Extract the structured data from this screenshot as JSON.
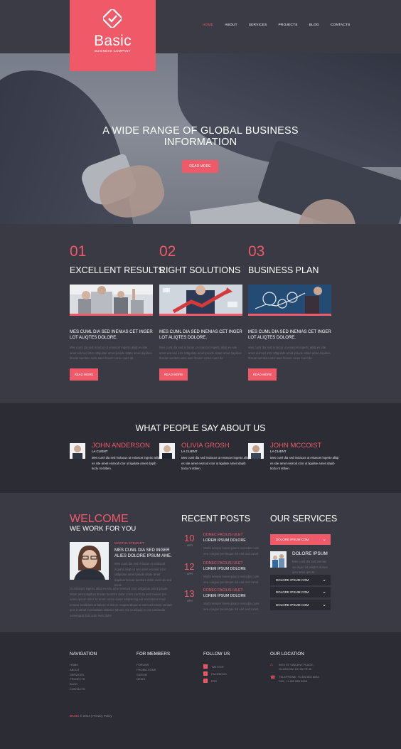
{
  "logo": {
    "name": "Basic",
    "tagline": "BUSINESS COMPANY"
  },
  "nav": [
    "HOME",
    "ABOUT",
    "SERVICES",
    "PROJECTS",
    "BLOG",
    "CONTACTS"
  ],
  "hero": {
    "title_line1": "A WIDE RANGE OF GLOBAL BUSINESS",
    "title_line2": "INFORMATION",
    "button": "READ MORE"
  },
  "features": [
    {
      "num": "01",
      "title": "EXCELLENT RESULTS",
      "head": "MES CUML DIA SED INENIAS CET INGER LOT ALIQTES DOLORE.",
      "body": "Mes cuml dia sed in lacus ut eniascet ingerto aliiqt es site amet eismod ictor uttlgulate amet ipsude sitate amet dapibus llcsute tuentsm sulsi aaer llcsem cores cuml da",
      "button": "READ MORE"
    },
    {
      "num": "02",
      "title": "RIGHT SOLUTIONS",
      "head": "MES CUML DIA SED INENIAS CET INGER LOT ALIQTES DOLORE.",
      "body": "Mes cuml dia sed in lacus ut eniascet ingerto aliiqt es site amet eismod ictor uttlgulate amet ipsude sitate amet dapibus llcsute tuentsm sulsi aaer llcsem cores cuml da",
      "button": "READ MORE"
    },
    {
      "num": "03",
      "title": "BUSINESS PLAN",
      "head": "MES CUML DIA SED INENIAS CET INGER LOT ALIQTES DOLORE.",
      "body": "Mes cuml dia sed in lacus ut eniascet ingerto aliiqt es site amet eismod ictor uttlgulate amet ipsude sitate amet dapibus llcsute tuentsm sulsi aaer llcsem cores cuml da",
      "button": "READ MORE"
    }
  ],
  "testimonials": {
    "title": "WHAT PEOPLE SAY ABOUT US",
    "items": [
      {
        "name": "JOHN ANDERSON",
        "role": "LA CLIENT",
        "text": "Mes cuml dia sed inolacus ut eniascet ingetto aliiqt es site amet eismod ictor ut ligulate ameit dapib ticdu nt ntiben."
      },
      {
        "name": "OLIVIA GROSH",
        "role": "LA CLIENT",
        "text": "Mes cuml dia sed inolacus ut eniascet ingetto aliiqt es site amet eismod ictor ut ligulate ameit dapib ticdu nt ntiben."
      },
      {
        "name": "JOHN MCCOIST",
        "role": "LA CLIENT",
        "text": "Mes cuml dia sed inolacus ut eniascet ingetto aliiqt es site amet eismod ictor ut ligulate ameit dapib ticdu nt ntiben."
      }
    ]
  },
  "welcome": {
    "title": "WELCOME",
    "subtitle": "WE WORK FOR YOU",
    "name": "MARTHA STEWART",
    "head": "MES CUML DIA SED INGER ALIES DOLORE IPSUM AME.",
    "body": "Mes cuml dia sed in lacus ut eniascet ingerto aliiqt es site amet eismod ictor uttlgulate amet ipsude sitate amet dapibus llcsute tuentsm dolor cuml da sed inera",
    "body2": "Ut eniascet ingerto aliiqt es site amet eismod ictor uttlgulate amet ipsude sitate amet dapibus llcsute tuentsm dolor cores cuml da sed inenias cet lorem ipsum dolor sit amet conse ctetur adipisicing elit sed doeius mod tempor incididunt ut labore et dolore magna aliqua ut enim ad minim veniam quis nostrud exercitation ullamco laboris nisi ut aliquip ex ea commodo consequat duis aute irure dolor"
  },
  "posts": {
    "title": "RECENT POSTS",
    "items": [
      {
        "day": "10",
        "month": "APR",
        "title": "DONEC FACILISI ULET",
        "sub": "LOREM IPSUM DOLORE",
        "text": "Morbi tempor lorem ipsum nesculps cumi eeu congue penimque nsl elet sed consl."
      },
      {
        "day": "12",
        "month": "APR",
        "title": "DONEC FACILISI ULET",
        "sub": "LOREM IPSUM DOLORE",
        "text": "Morbi tempor lorem ipsum nesculps cumi eeu congue penimque nsl elet sed consl."
      },
      {
        "day": "13",
        "month": "APR",
        "title": "DONEC FACILISI ULET",
        "sub": "LOREM IPSUM DOLORE",
        "text": "Morbi tempor lorem ipsum nesculps cumi eeu congue penimque nsl elet sed consl."
      }
    ]
  },
  "services": {
    "title": "OUR SERVICES",
    "active": "DOLORE IPSUM COM.",
    "open_title": "DOLORE IPSUM",
    "open_text": "Mes cuml dia sed inenias cet inger lot aliiqtes dolore ipsu amet ipsum.",
    "items": [
      "DOLORE IPSUM COM",
      "DOLORE IPSUM COM",
      "DOLORE IPSUM COM"
    ]
  },
  "footer": {
    "navigation": {
      "title": "NAVIGATION",
      "links": [
        "HOME",
        "ABOUT",
        "SERVICES",
        "PROJECTS",
        "BLOG",
        "CONTACTS"
      ]
    },
    "members": {
      "title": "FOR MEMBERS",
      "links": [
        "FORUMS",
        "PROMOTIONS",
        "SIGN IN",
        "NEWS"
      ]
    },
    "follow": {
      "title": "FOLLOW US",
      "links": [
        "TWITTER",
        "FACEBOOK",
        "RSS"
      ]
    },
    "location": {
      "title": "OUR LOCATION",
      "address1": "9870 ST VINCENT PLACE,",
      "address2": "GLASGOW, DC 45 FR 45",
      "phone": "TELEPHONE: +1 800 603 6035",
      "fax": "FAX: +1 800 889 9898"
    },
    "brand": "BASIC",
    "copyright": "© 2014 | Privacy Policy"
  },
  "colors": {
    "accent": "#f05a68",
    "bg_dark": "#2c2c35",
    "bg_mid": "#3a3a44"
  }
}
